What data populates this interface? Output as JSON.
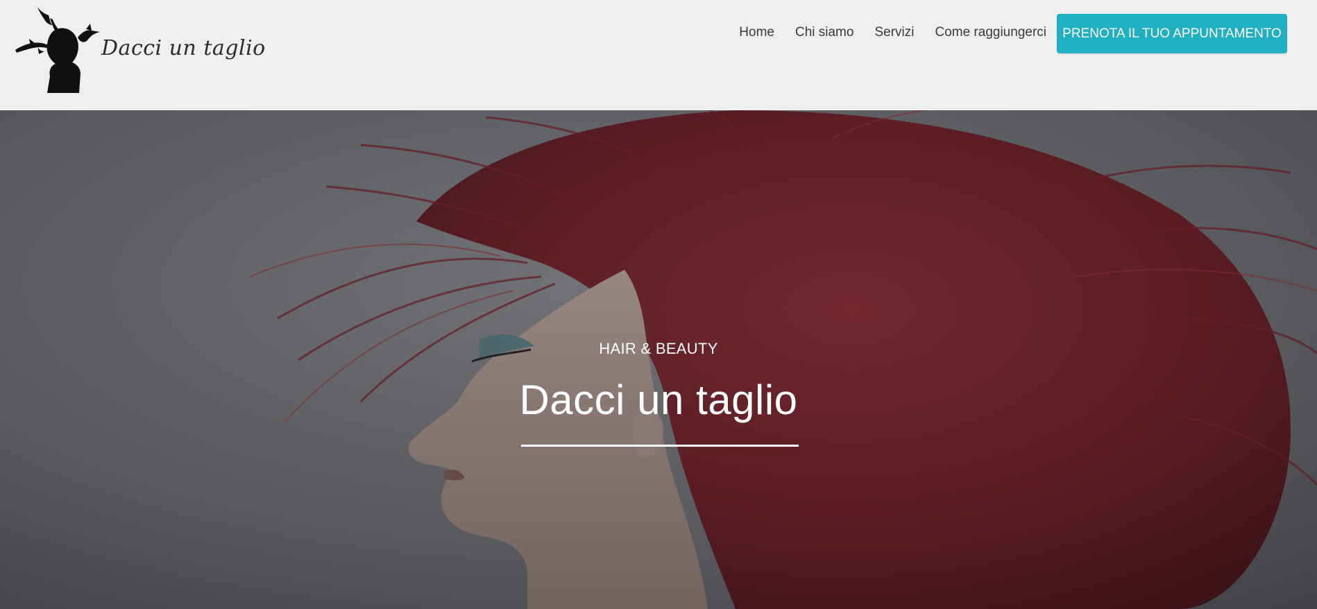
{
  "header": {
    "logo_text": "Dacci un taglio",
    "nav": [
      {
        "label": "Home"
      },
      {
        "label": "Chi siamo"
      },
      {
        "label": "Servizi"
      },
      {
        "label": "Come raggiungerci"
      }
    ],
    "cta_label": "PRENOTA IL TUO APPUNTAMENTO"
  },
  "hero": {
    "eyebrow": "HAIR & BEAUTY",
    "title": "Dacci un taglio"
  },
  "colors": {
    "header_bg": "#efefef",
    "cta_bg": "#20b0c2",
    "nav_text": "#3a3a3a",
    "hero_text": "#ffffff"
  },
  "icons": {
    "logo": "woman-silhouette-with-birds-icon"
  }
}
